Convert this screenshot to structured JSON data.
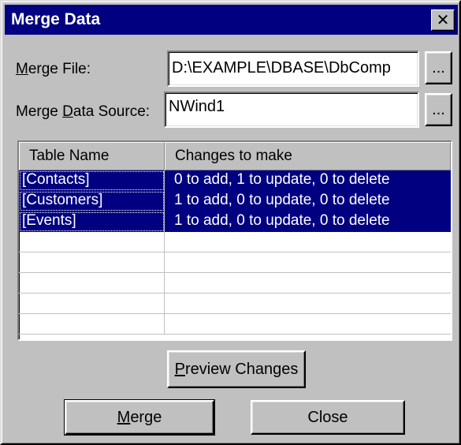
{
  "window": {
    "title": "Merge Data",
    "close_glyph": "✕"
  },
  "merge_file": {
    "label_prefix": "",
    "label_mnemonic": "M",
    "label_rest": "erge File:",
    "value": "D:\\EXAMPLE\\DBASE\\DbComp",
    "browse_label": "..."
  },
  "merge_source": {
    "label_prefix": "Merge ",
    "label_mnemonic": "D",
    "label_rest": "ata Source:",
    "value": "NWind1",
    "browse_label": "..."
  },
  "grid": {
    "columns": [
      "Table Name",
      "Changes to make"
    ],
    "rows": [
      {
        "table": "[Contacts]",
        "changes": "0 to add, 1 to update, 0 to delete",
        "selected": true
      },
      {
        "table": "[Customers]",
        "changes": "1 to add, 0 to update, 0 to delete",
        "selected": true
      },
      {
        "table": "[Events]",
        "changes": "1 to add, 0 to update, 0 to delete",
        "selected": true
      },
      {
        "table": "",
        "changes": "",
        "selected": false
      },
      {
        "table": "",
        "changes": "",
        "selected": false
      },
      {
        "table": "",
        "changes": "",
        "selected": false
      },
      {
        "table": "",
        "changes": "",
        "selected": false
      },
      {
        "table": "",
        "changes": "",
        "selected": false
      }
    ]
  },
  "buttons": {
    "preview": {
      "mnemonic": "P",
      "rest": "review Changes"
    },
    "merge": {
      "mnemonic": "M",
      "rest": "erge"
    },
    "close": {
      "label": "Close"
    }
  },
  "colors": {
    "selection": "#000080",
    "face": "#c0c0c0",
    "title": "#000080"
  }
}
